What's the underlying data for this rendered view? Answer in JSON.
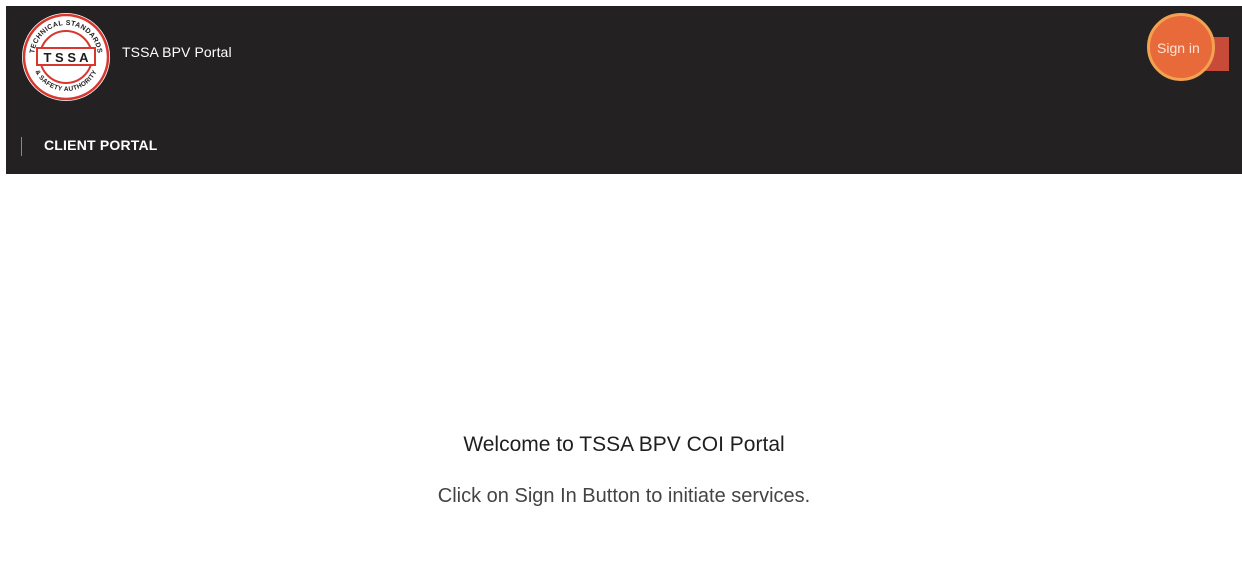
{
  "header": {
    "brand_title": "TSSA BPV Portal",
    "logo": {
      "icon": "tssa-logo-icon",
      "center_text": "T S S A",
      "ring_top_text": "TECHNICAL STANDARDS",
      "ring_bottom_text": "& SAFETY AUTHORITY",
      "ring_color": "#d7372f"
    },
    "sign_in_label": "Sign in",
    "nav": {
      "items": [
        {
          "label": "CLIENT PORTAL"
        }
      ]
    }
  },
  "main": {
    "welcome_title": "Welcome to TSSA BPV COI Portal",
    "welcome_subtitle": "Click on Sign In Button to initiate services."
  },
  "colors": {
    "header_bg": "#232121",
    "accent": "#e86a3a",
    "accent_ring": "#f2a250",
    "page_bg": "#ffffff"
  }
}
